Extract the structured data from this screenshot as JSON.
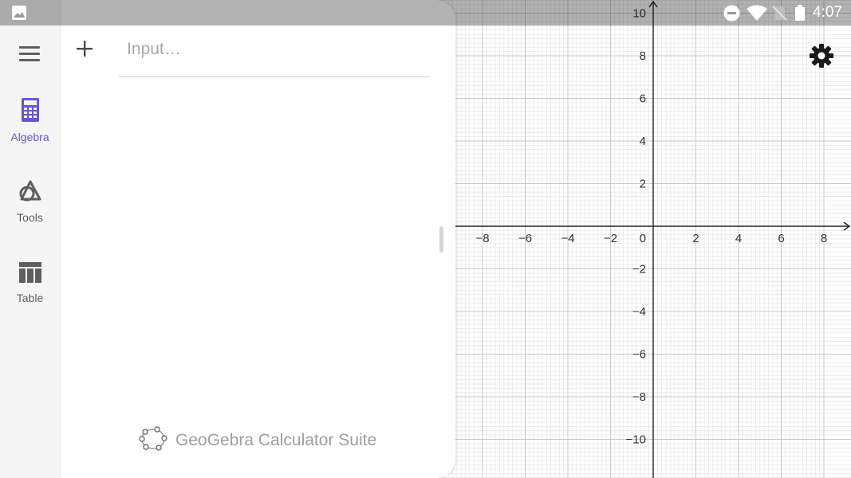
{
  "status_bar": {
    "time": "4:07",
    "icons": [
      "image-notification-icon",
      "do-not-disturb-icon",
      "wifi-icon",
      "no-sim-icon",
      "battery-icon"
    ]
  },
  "nav_rail": {
    "menu_icon": "hamburger-menu-icon",
    "items": [
      {
        "label": "Algebra",
        "icon": "calculator-icon",
        "active": true
      },
      {
        "label": "Tools",
        "icon": "shapes-tools-icon",
        "active": false
      },
      {
        "label": "Table",
        "icon": "table-icon",
        "active": false
      }
    ]
  },
  "algebra_panel": {
    "input_placeholder": "Input…",
    "input_value": "",
    "add_icon": "plus-icon",
    "footer_brand": "GeoGebra Calculator Suite",
    "footer_icon": "geogebra-logo-icon"
  },
  "graphics_view": {
    "settings_icon": "gear-icon",
    "x_ticks": [
      "−8",
      "−6",
      "−4",
      "−2",
      "2",
      "4",
      "6",
      "8"
    ],
    "y_ticks": [
      "10",
      "8",
      "6",
      "4",
      "2",
      "−2",
      "−4",
      "−6",
      "−8",
      "−10"
    ],
    "origin_label": "0",
    "grid": true,
    "colors": {
      "accent": "#6557d2",
      "axis": "#222222",
      "major_grid": "#c8c8c8",
      "minor_grid": "#e8e8e8"
    }
  }
}
